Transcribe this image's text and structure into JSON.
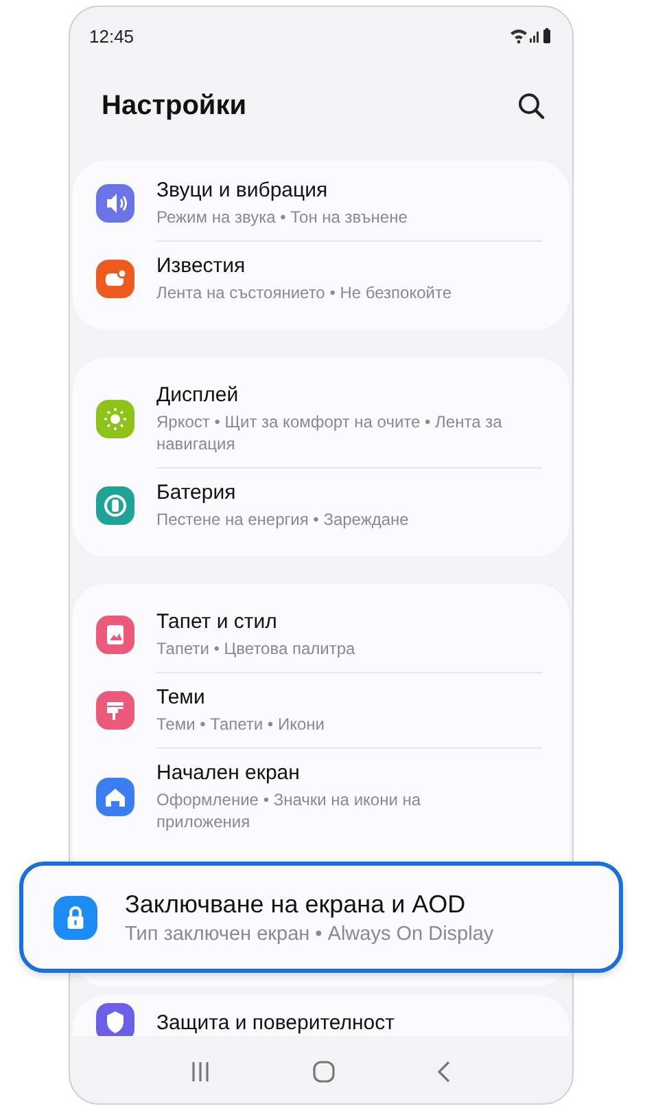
{
  "status_bar": {
    "time": "12:45"
  },
  "header": {
    "title": "Настройки"
  },
  "groups": [
    {
      "items": [
        {
          "title": "Звуци и вибрация",
          "subtitle": "Режим на звука  •  Тон на звънене",
          "color": "#6b73e8",
          "highlighted": false
        },
        {
          "title": "Известия",
          "subtitle": "Лента на състоянието  •  Не безпокойте",
          "color": "#ee5b1e",
          "highlighted": false
        }
      ]
    },
    {
      "items": [
        {
          "title": "Дисплей",
          "subtitle": "Яркост  •  Щит за комфорт на очите  •  Лента за навигация",
          "color": "#8ec21a",
          "highlighted": false
        },
        {
          "title": "Батерия",
          "subtitle": "Пестене на енергия  •  Зареждане",
          "color": "#1fa396",
          "highlighted": false
        }
      ]
    },
    {
      "items": [
        {
          "title": "Тапет и стил",
          "subtitle": "Тапети  •  Цветова палитра",
          "color": "#eb5a7a",
          "highlighted": false
        },
        {
          "title": "Теми",
          "subtitle": "Теми  •  Тапети  •  Икони",
          "color": "#eb5a7a",
          "highlighted": false
        },
        {
          "title": "Начален екран",
          "subtitle": "Оформление  •  Значки на икони на приложения",
          "color": "#3a7ef0",
          "highlighted": false
        },
        {
          "title": "Заключване на екрана и AOD",
          "subtitle": "Тип заключен екран  •  Always On Display",
          "color": "#1e8cf5",
          "highlighted": true
        }
      ]
    },
    {
      "items": [
        {
          "title": "Защита и поверителност",
          "color": "#6b5fe8",
          "highlighted": false
        }
      ]
    }
  ]
}
